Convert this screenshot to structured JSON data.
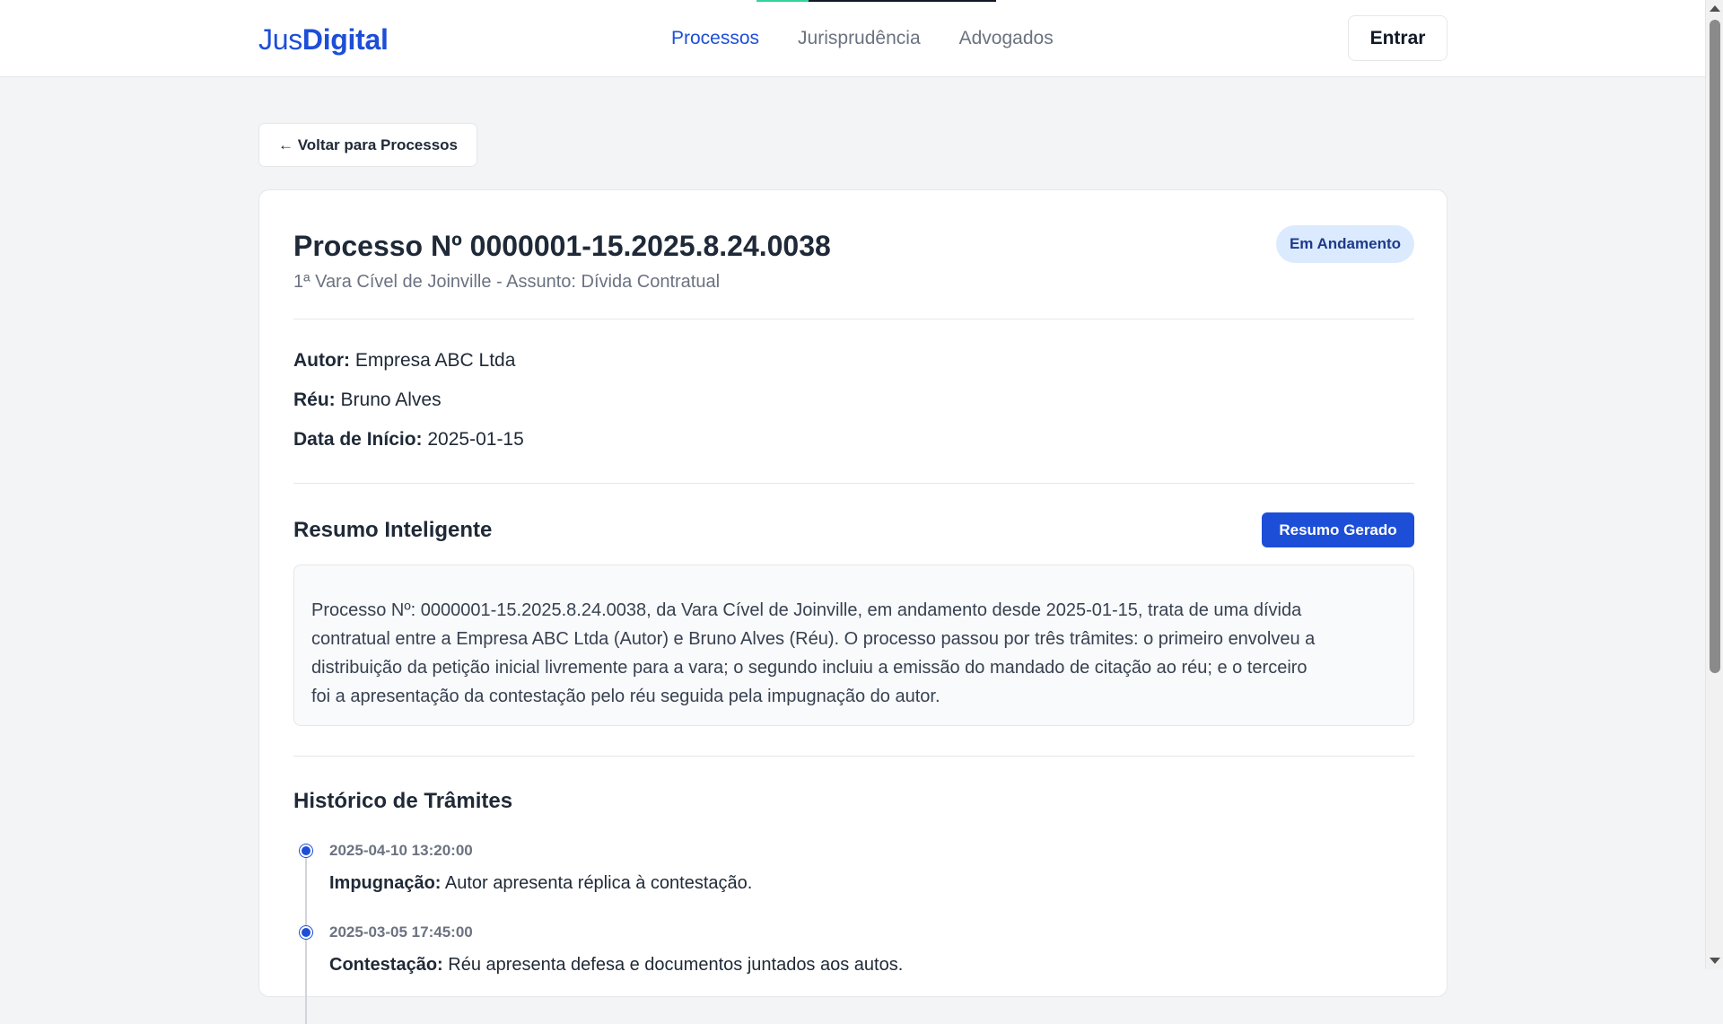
{
  "header": {
    "logo_part1": "Jus",
    "logo_part2": "Digital",
    "nav": [
      {
        "label": "Processos",
        "active": true
      },
      {
        "label": "Jurisprudência",
        "active": false
      },
      {
        "label": "Advogados",
        "active": false
      }
    ],
    "login_label": "Entrar"
  },
  "back_label": "← Voltar para Processos",
  "process": {
    "title": "Processo Nº 0000001-15.2025.8.24.0038",
    "subtitle": "1ª Vara Cível de Joinville - Assunto: Dívida Contratual",
    "status": "Em Andamento",
    "details": [
      {
        "label": "Autor:",
        "value": "Empresa ABC Ltda"
      },
      {
        "label": "Réu:",
        "value": "Bruno Alves"
      },
      {
        "label": "Data de Início:",
        "value": "2025-01-15"
      }
    ]
  },
  "summary": {
    "title": "Resumo Inteligente",
    "button_label": "Resumo Gerado",
    "lines": [
      "Processo Nº: 0000001-15.2025.8.24.0038, da Vara Cível de Joinville, em andamento desde 2025-01-15, trata de uma dívida",
      "contratual entre a Empresa ABC Ltda (Autor) e Bruno Alves (Réu). O processo passou por três trâmites: o primeiro envolveu a",
      "distribuição da petição inicial livremente para a vara; o segundo incluiu a emissão do mandado de citação ao réu; e o terceiro",
      "foi a apresentação da contestação pelo réu seguida pela impugnação do autor."
    ]
  },
  "history": {
    "title": "Histórico de Trâmites",
    "items": [
      {
        "date": "2025-04-10 13:20:00",
        "label": "Impugnação:",
        "text": "Autor apresenta réplica à contestação."
      },
      {
        "date": "2025-03-05 17:45:00",
        "label": "Contestação:",
        "text": "Réu apresenta defesa e documentos juntados aos autos."
      }
    ]
  },
  "colors": {
    "accent": "#1d4ed8",
    "badge_bg": "#dbeafe",
    "page_bg": "#f3f4f6"
  }
}
